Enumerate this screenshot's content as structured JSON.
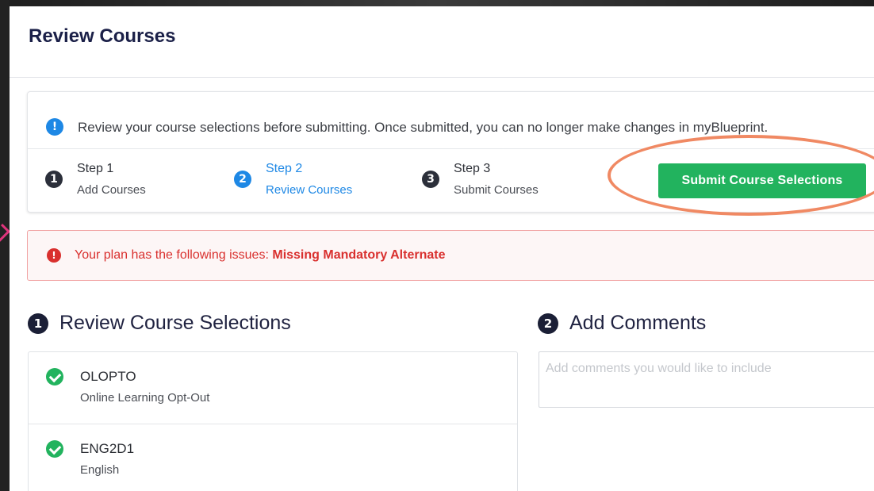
{
  "header": {
    "title": "Review Courses"
  },
  "info": {
    "icon": "info-icon",
    "message": "Review your course selections before submitting. Once submitted, you can no longer make changes in myBlueprint."
  },
  "steps": [
    {
      "number": "1",
      "title": "Step 1",
      "subtitle": "Add Courses",
      "active": false
    },
    {
      "number": "2",
      "title": "Step 2",
      "subtitle": "Review Courses",
      "active": true
    },
    {
      "number": "3",
      "title": "Step 3",
      "subtitle": "Submit Courses",
      "active": false
    }
  ],
  "submit": {
    "label": "Submit Course Selections"
  },
  "issues": {
    "prefix": "Your plan has the following issues:",
    "issue": "Missing Mandatory Alternate",
    "icon": "exclamation-icon"
  },
  "sections": {
    "review": {
      "number": "1",
      "title": "Review Course Selections"
    },
    "comments": {
      "number": "2",
      "title": "Add Comments",
      "placeholder": "Add comments you would like to include"
    }
  },
  "courses": [
    {
      "code": "OLOPTO",
      "name": "Online Learning Opt-Out"
    },
    {
      "code": "ENG2D1",
      "name": "English"
    }
  ],
  "colors": {
    "accent": "#1e88e5",
    "success": "#22b35e",
    "error": "#d9302e",
    "annotation": "#f08963",
    "title": "#1b2048"
  }
}
